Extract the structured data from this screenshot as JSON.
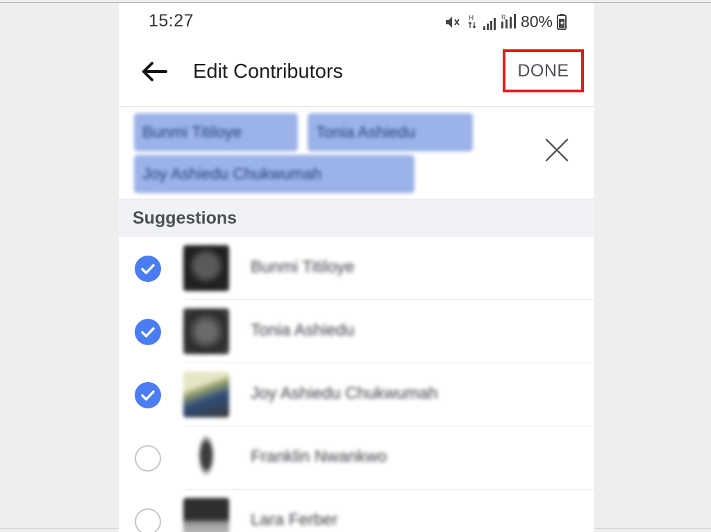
{
  "status_bar": {
    "time": "15:27",
    "network_label": "H",
    "battery": "80%",
    "icons": [
      "mute-icon",
      "network-type-icon",
      "signal-icon",
      "roaming-signal-icon",
      "battery-icon"
    ]
  },
  "app_bar": {
    "title": "Edit Contributors",
    "done_label": "DONE",
    "back_icon": "back-arrow-icon"
  },
  "selected_chips": [
    {
      "label": "Bunmi Titiloye"
    },
    {
      "label": "Tonia Ashiedu"
    },
    {
      "label": "Joy Ashiedu Chukwumah"
    }
  ],
  "clear_icon": "close-icon",
  "suggestions": {
    "header": "Suggestions",
    "items": [
      {
        "name": "Bunmi Titiloye",
        "selected": true
      },
      {
        "name": "Tonia Ashiedu",
        "selected": true
      },
      {
        "name": "Joy Ashiedu Chukwumah",
        "selected": true
      },
      {
        "name": "Franklin Nwankwo",
        "selected": false
      },
      {
        "name": "Lara Ferber",
        "selected": false
      }
    ]
  },
  "colors": {
    "highlight_box": "#e41b1b",
    "chip": "#9bb3e8",
    "check_on": "#4a7cf3"
  }
}
